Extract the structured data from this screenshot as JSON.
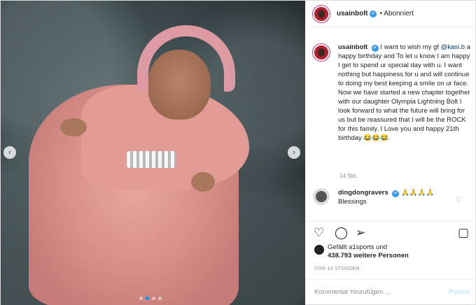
{
  "post": {
    "username": "usainbolt",
    "follow_status": "Abonniert",
    "caption_mention": "@kasi.b",
    "caption_before": "I want to wish my gf",
    "caption_after": "a happy birthday and To let u know I am happy I get to spend ur special day with u. I want nothing but happiness for u and will continue to doing my best keeping a smile on ur face. Now we have started a new chapter together with our daughter Olympia Lightning Bolt I look forward to what the future will bring for us but be reassured that I will be the ROCK for this family. I Love you and happy 21th birthday 😂😂😂.",
    "caption_time": "14 Std."
  },
  "comment": {
    "username": "dingdongravers",
    "emojis": "🙏🙏🙏🙏",
    "text": "Blessings"
  },
  "likes": {
    "line1": "Gefällt a1sports und",
    "line2": "438.793 weitere Personen",
    "ago": "VOR 14 STUNDEN"
  },
  "add_comment": {
    "placeholder": "Kommentar hinzufügen ...",
    "post_label": "Posten"
  },
  "icons": {
    "verified": "✔",
    "nav_prev": "‹",
    "nav_next": "›",
    "like": "♡",
    "comment": "◯",
    "share": "➢",
    "save": "▢"
  },
  "colors": {
    "accent_blue": "#0095f6",
    "verified_blue": "#3897f0"
  }
}
